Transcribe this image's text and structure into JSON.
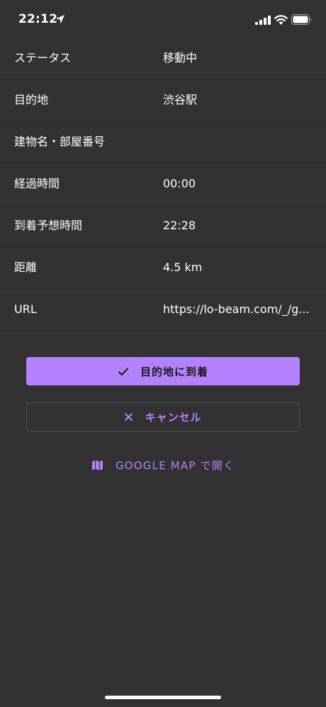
{
  "status_bar": {
    "time": "22:12"
  },
  "info_rows": [
    {
      "label": "ステータス",
      "value": "移動中"
    },
    {
      "label": "目的地",
      "value": "渋谷駅"
    },
    {
      "label": "建物名・部屋番号",
      "value": ""
    },
    {
      "label": "経過時間",
      "value": "00:00"
    },
    {
      "label": "到着予想時間",
      "value": "22:28"
    },
    {
      "label": "距離",
      "value": "4.5 km"
    },
    {
      "label": "URL",
      "value": "https://lo-beam.com/_/g..."
    }
  ],
  "actions": {
    "arrive_label": "目的地に到着",
    "cancel_label": "キャンセル",
    "map_label": "GOOGLE MAP で開く"
  },
  "colors": {
    "background": "#323232",
    "accent": "#b482ff",
    "divider": "#272727"
  },
  "icons": {
    "arrive": "check-icon",
    "cancel": "close-icon",
    "map": "map-icon"
  }
}
